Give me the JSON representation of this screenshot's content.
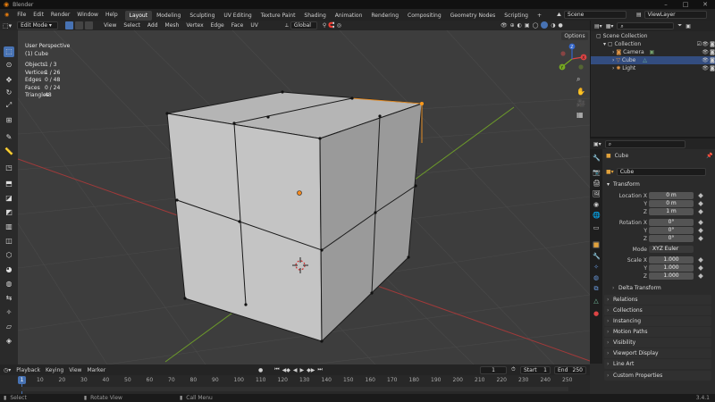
{
  "titlebar": {
    "app_title": "Blender"
  },
  "menu": [
    "File",
    "Edit",
    "Render",
    "Window",
    "Help"
  ],
  "workspaces": [
    "Layout",
    "Modeling",
    "Sculpting",
    "UV Editing",
    "Texture Paint",
    "Shading",
    "Animation",
    "Rendering",
    "Compositing",
    "Geometry Nodes",
    "Scripting"
  ],
  "active_workspace": "Layout",
  "scene": {
    "scene_name": "Scene",
    "view_layer": "ViewLayer"
  },
  "viewport_header": {
    "mode": "Edit Mode",
    "menus": [
      "View",
      "Select",
      "Add",
      "Mesh",
      "Vertex",
      "Edge",
      "Face",
      "UV"
    ],
    "transform_orientation": "Global",
    "options_label": "Options"
  },
  "overlay": {
    "view_name": "User Perspective",
    "object_name": "(1) Cube",
    "stats": [
      {
        "label": "Objects",
        "value": "1 / 3"
      },
      {
        "label": "Vertices",
        "value": "1 / 26"
      },
      {
        "label": "Edges",
        "value": "0 / 48"
      },
      {
        "label": "Faces",
        "value": "0 / 24"
      },
      {
        "label": "Triangles",
        "value": "48"
      }
    ]
  },
  "gizmo_axes": [
    "X",
    "Y",
    "Z"
  ],
  "outliner": {
    "root": "Scene Collection",
    "items": [
      {
        "label": "Collection"
      },
      {
        "label": "Camera"
      },
      {
        "label": "Cube"
      },
      {
        "label": "Light"
      }
    ]
  },
  "properties": {
    "object_name": "Cube",
    "datablock_name": "Cube",
    "transform_title": "Transform",
    "rows": [
      {
        "label": "Location X",
        "value": "0 m"
      },
      {
        "label": "Y",
        "value": "0 m"
      },
      {
        "label": "Z",
        "value": "1 m"
      },
      {
        "label": "Rotation X",
        "value": "0°"
      },
      {
        "label": "Y",
        "value": "0°"
      },
      {
        "label": "Z",
        "value": "0°"
      },
      {
        "label": "Mode",
        "value": "XYZ Euler"
      },
      {
        "label": "Scale X",
        "value": "1.000"
      },
      {
        "label": "Y",
        "value": "1.000"
      },
      {
        "label": "Z",
        "value": "1.000"
      }
    ],
    "delta_transform": "Delta Transform",
    "panels": [
      "Relations",
      "Collections",
      "Instancing",
      "Motion Paths",
      "Visibility",
      "Viewport Display",
      "Line Art",
      "Custom Properties"
    ]
  },
  "timeline": {
    "menus": [
      "Playback",
      "Keying",
      "View",
      "Marker"
    ],
    "current_frame": "1",
    "start_label": "Start",
    "start": "1",
    "end_label": "End",
    "end": "250",
    "ticks": [
      "1",
      "10",
      "20",
      "30",
      "40",
      "50",
      "60",
      "70",
      "80",
      "90",
      "100",
      "110",
      "120",
      "130",
      "140",
      "150",
      "160",
      "170",
      "180",
      "190",
      "200",
      "210",
      "220",
      "230",
      "240",
      "250"
    ]
  },
  "statusbar": {
    "select": "Select",
    "rotate": "Rotate View",
    "call_menu": "Call Menu",
    "version": "3.4.1"
  }
}
